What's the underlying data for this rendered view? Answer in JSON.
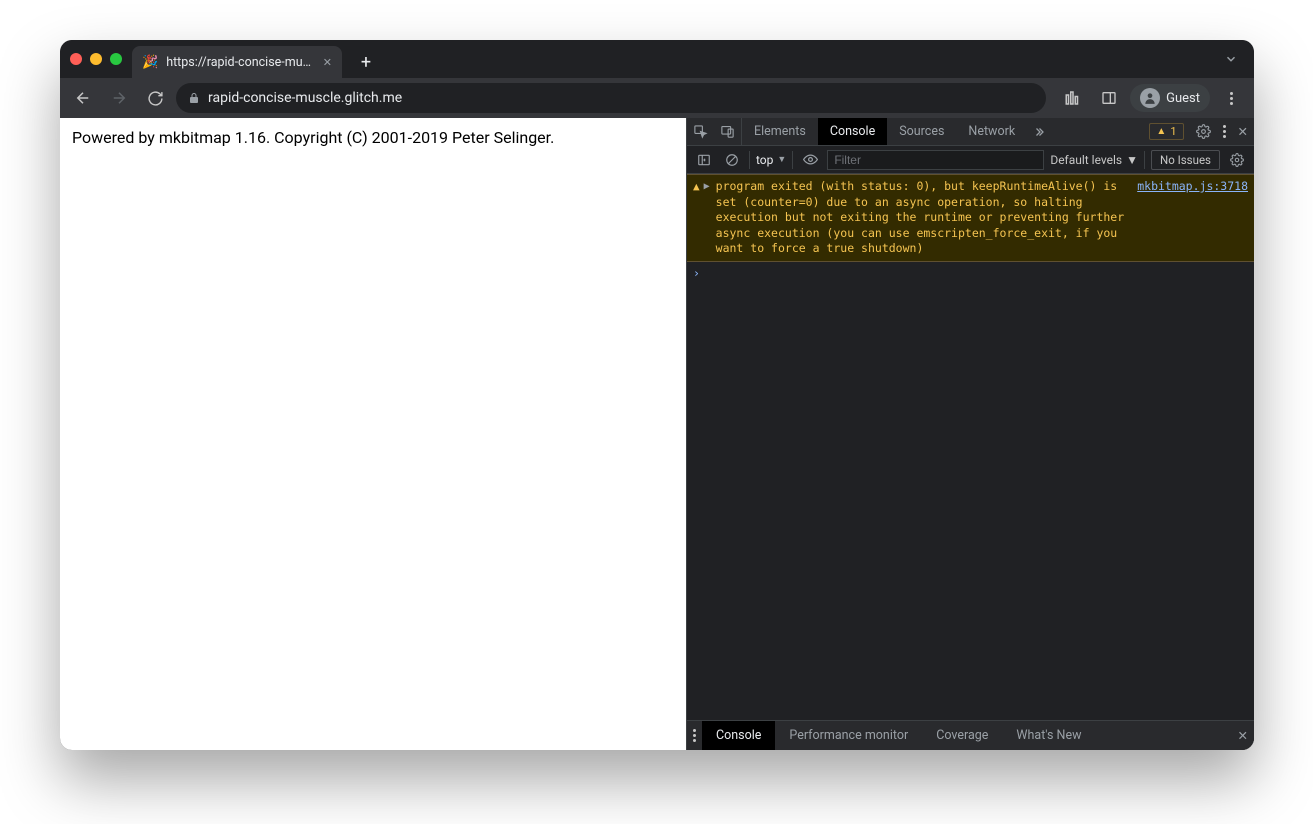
{
  "browser": {
    "tab_title": "https://rapid-concise-muscle.g",
    "address": "rapid-concise-muscle.glitch.me",
    "guest_label": "Guest"
  },
  "page": {
    "body_text": "Powered by mkbitmap 1.16. Copyright (C) 2001-2019 Peter Selinger."
  },
  "devtools": {
    "tabs": {
      "elements": "Elements",
      "console": "Console",
      "sources": "Sources",
      "network": "Network"
    },
    "warn_count": "1",
    "filter": {
      "context": "top",
      "placeholder": "Filter",
      "levels": "Default levels",
      "issues": "No Issues"
    },
    "log": {
      "warning_message": "program exited (with status: 0), but keepRuntimeAlive() is set (counter=0) due to an async operation, so halting execution but not exiting the runtime or preventing further async execution (you can use emscripten_force_exit, if you want to force a true shutdown)",
      "warning_source": "mkbitmap.js:3718"
    },
    "drawer": {
      "console": "Console",
      "perf": "Performance monitor",
      "coverage": "Coverage",
      "whatsnew": "What's New"
    }
  }
}
